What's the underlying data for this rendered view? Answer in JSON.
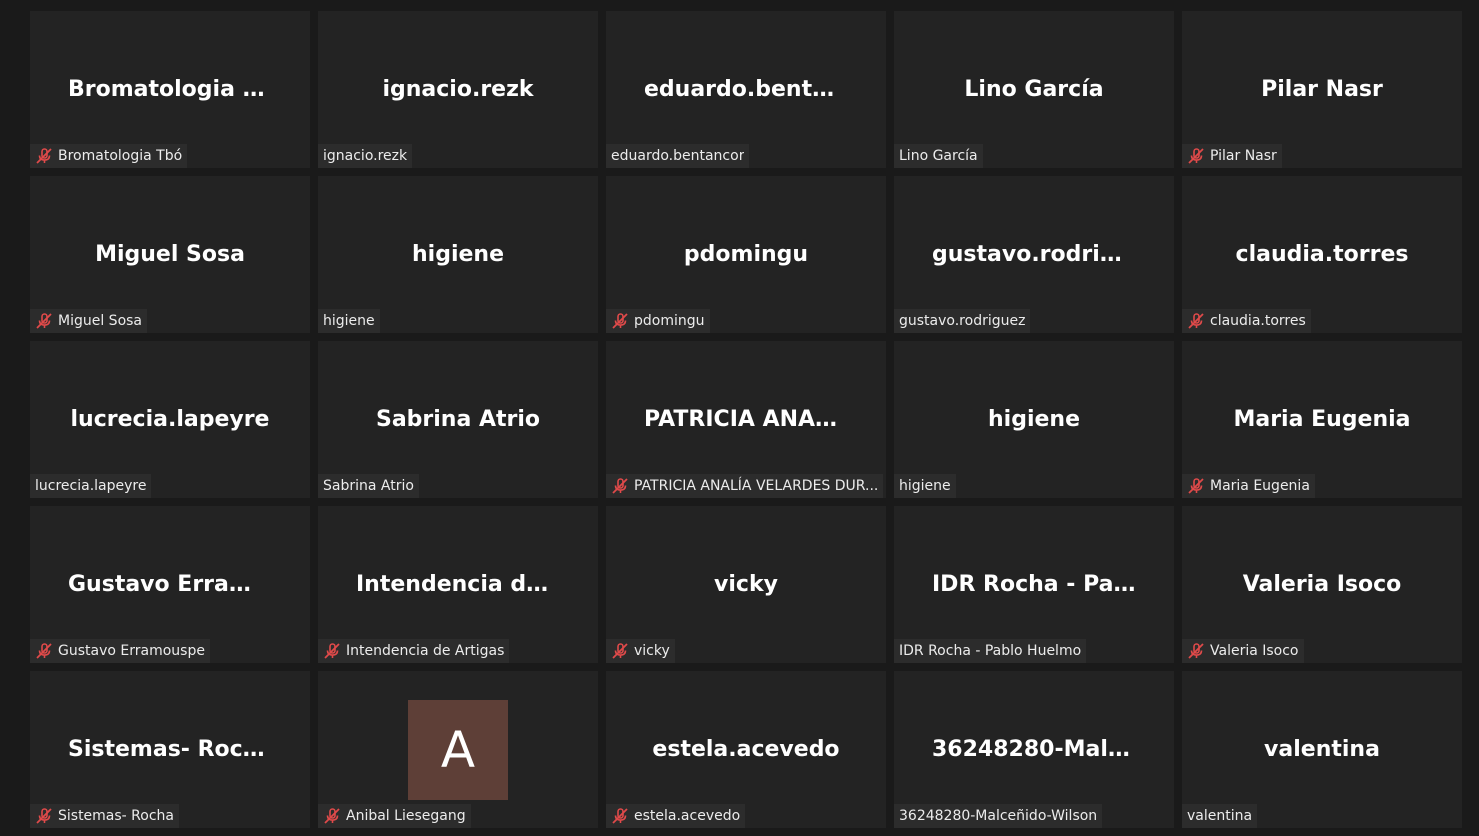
{
  "colors": {
    "background": "#1a1a1a",
    "tile": "#232323",
    "label_bg": "#2c2c2c",
    "muted_icon": "#e04a4a",
    "avatar_bg": "#5e3f37"
  },
  "participants": [
    {
      "display": "Bromatologia  T...",
      "label": "Bromatologia Tbó",
      "muted": true
    },
    {
      "display": "ignacio.rezk",
      "label": "ignacio.rezk",
      "muted": false
    },
    {
      "display": "eduardo.bentan...",
      "label": "eduardo.bentancor",
      "muted": false
    },
    {
      "display": "Lino García",
      "label": "Lino García",
      "muted": false
    },
    {
      "display": "Pilar Nasr",
      "label": "Pilar Nasr",
      "muted": true
    },
    {
      "display": "Miguel Sosa",
      "label": "Miguel Sosa",
      "muted": true
    },
    {
      "display": "higiene",
      "label": "higiene",
      "muted": false
    },
    {
      "display": "pdomingu",
      "label": "pdomingu",
      "muted": true
    },
    {
      "display": "gustavo.rodrigu...",
      "label": "gustavo.rodriguez",
      "muted": false
    },
    {
      "display": "claudia.torres",
      "label": "claudia.torres",
      "muted": true
    },
    {
      "display": "lucrecia.lapeyre",
      "label": "lucrecia.lapeyre",
      "muted": false
    },
    {
      "display": "Sabrina Atrio",
      "label": "Sabrina Atrio",
      "muted": false
    },
    {
      "display": "PATRICIA  ANAL...",
      "label": "PATRICIA ANALÍA VELARDES DUR...",
      "muted": true
    },
    {
      "display": "higiene",
      "label": "higiene",
      "muted": false
    },
    {
      "display": "Maria Eugenia",
      "label": "Maria Eugenia",
      "muted": true
    },
    {
      "display": "Gustavo  Erramo...",
      "label": "Gustavo Erramouspe",
      "muted": true
    },
    {
      "display": "Intendencia  de...",
      "label": "Intendencia de Artigas",
      "muted": true
    },
    {
      "display": "vicky",
      "label": "vicky",
      "muted": true
    },
    {
      "display": "IDR Rocha  -  Pab...",
      "label": "IDR Rocha - Pablo Huelmo",
      "muted": false
    },
    {
      "display": "Valeria Isoco",
      "label": "Valeria Isoco",
      "muted": true
    },
    {
      "display": "Sistemas- Rocha",
      "label": "Sistemas- Rocha",
      "muted": true
    },
    {
      "display": "",
      "avatar": "A",
      "label": "Anibal Liesegang",
      "muted": true
    },
    {
      "display": "estela.acevedo",
      "label": "estela.acevedo",
      "muted": true
    },
    {
      "display": "36248280-Malc...",
      "label": "36248280-Malceñido-Wilson",
      "muted": false
    },
    {
      "display": "valentina",
      "label": "valentina",
      "muted": false
    }
  ]
}
